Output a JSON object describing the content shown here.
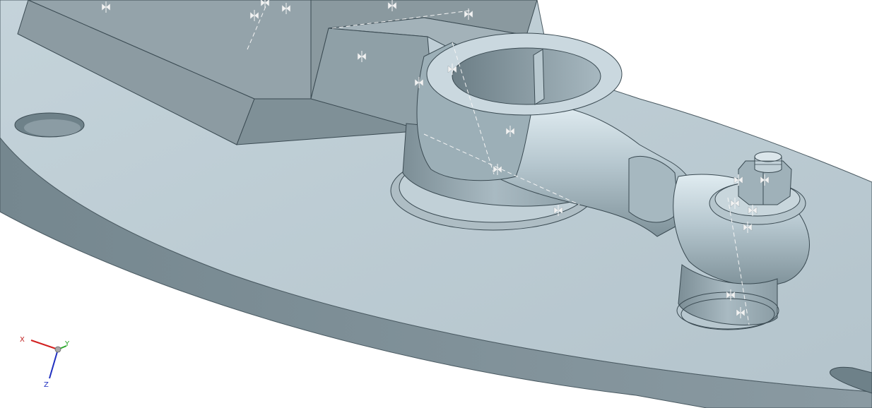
{
  "triad": {
    "x_label": "X",
    "y_label": "Y",
    "z_label": "Z",
    "x_color": "#d22020",
    "y_color": "#2aa82a",
    "z_color": "#2030c0"
  },
  "model_colors": {
    "background": "#ffffff",
    "plate_top": "#bccbd3",
    "plate_edge": "#7e8f97",
    "block_face": "#8d9ca3",
    "block_top": "#a4b3ba",
    "part_light": "#c7d6dd",
    "part_mid": "#9fb0b8",
    "part_dark": "#6f8189",
    "edge_line": "#3a4a52",
    "constraint_symbol": "#f2f2f2"
  },
  "icons": {
    "constraint": "coincident-constraint-icon",
    "triad": "view-triad-icon"
  }
}
